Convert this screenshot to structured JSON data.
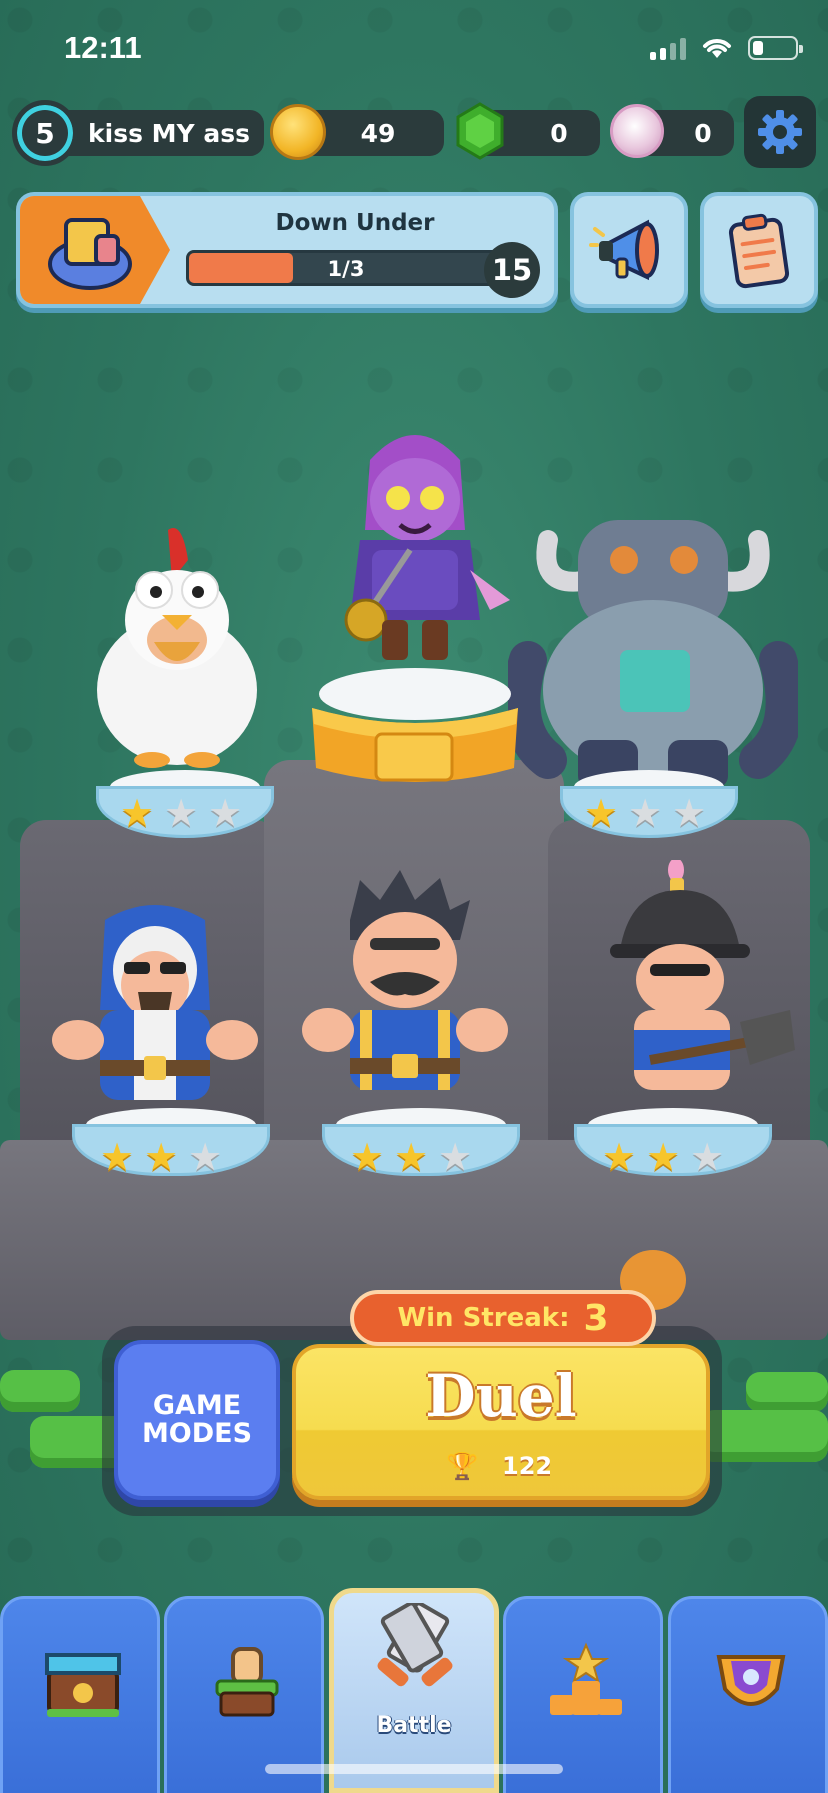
{
  "status_bar": {
    "time": "12:11"
  },
  "player": {
    "level": "5",
    "name": "kiss MY ass"
  },
  "currencies": {
    "coins": "49",
    "gems": "0",
    "tokens": "0"
  },
  "quest": {
    "title": "Down Under",
    "progress_text": "1/3",
    "progress_fraction": 0.33,
    "badge": "15"
  },
  "characters": [
    {
      "name": "chicken",
      "stars": 1
    },
    {
      "name": "witch",
      "stars": 0
    },
    {
      "name": "giant",
      "stars": 1
    },
    {
      "name": "wizard",
      "stars": 2
    },
    {
      "name": "barbarian",
      "stars": 2
    },
    {
      "name": "miner",
      "stars": 2
    }
  ],
  "battle": {
    "win_streak_label": "Win Streak:",
    "win_streak_value": "3",
    "game_modes_label": "GAME\nMODES",
    "duel_label": "Duel",
    "trophies": "122"
  },
  "nav": {
    "active_label": "Battle"
  },
  "colors": {
    "background": "#2f7a62",
    "duel": "#f6dc4f",
    "game_modes": "#5b7ef0",
    "streak": "#e8612e"
  }
}
